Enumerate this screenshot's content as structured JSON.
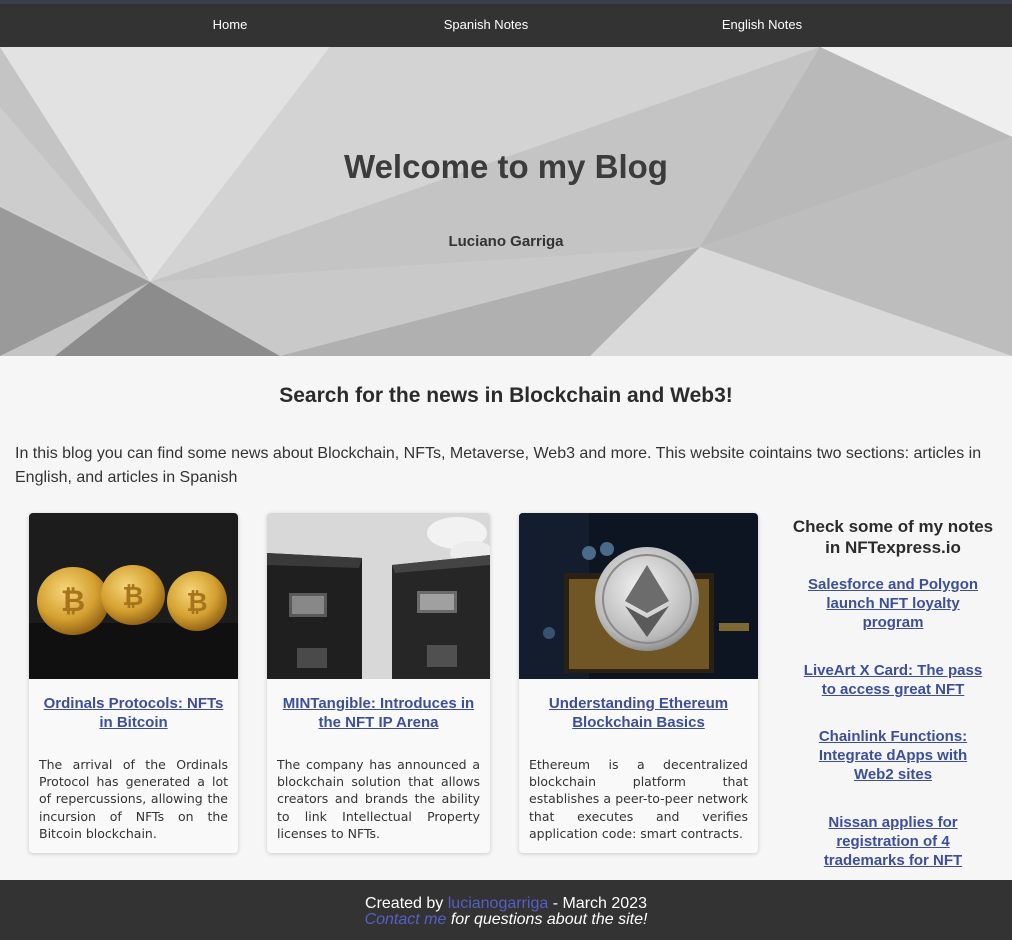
{
  "nav": {
    "items": [
      "Home",
      "Spanish Notes",
      "English Notes"
    ]
  },
  "hero": {
    "title": "Welcome to my Blog",
    "author": "Luciano Garriga"
  },
  "main": {
    "heading": "Search for the news in Blockchain and Web3!",
    "intro": "In this blog you can find some news about Blockchain, NFTs, Metaverse, Web3 and more. This website cointains two sections: articles in English, and articles in Spanish"
  },
  "cards": [
    {
      "title": "Ordinals Protocols: NFTs in Bitcoin",
      "text": "The arrival of the Ordinals Protocol has generated a lot of repercussions, allowing the incursion of NFTs on the Bitcoin blockchain.",
      "image": "bitcoin-coins-image"
    },
    {
      "title": "MINTangible: Introduces in the NFT IP Arena",
      "text": "The company has announced a blockchain solution that allows creators and brands the ability to link Intellectual Property licenses to NFTs.",
      "image": "buildings-image"
    },
    {
      "title": "Understanding Ethereum Blockchain Basics",
      "text": "Ethereum is a decentralized blockchain platform that establishes a peer-to-peer network that executes and verifies application code: smart contracts.",
      "image": "ethereum-coin-image"
    }
  ],
  "sidebar": {
    "heading": "Check some of my notes in NFTexpress.io",
    "links": [
      "Salesforce and Polygon launch NFT loyalty program",
      "LiveArt X Card: The pass to access great NFT",
      "Chainlink Functions: Integrate dApps with Web2 sites",
      "Nissan applies for registration of 4 trademarks for NFT"
    ]
  },
  "footer": {
    "created_prefix": "Created by",
    "author_link": "lucianogarriga",
    "date_suffix": "- March 2023",
    "contact_link": "Contact me",
    "contact_suffix": "for questions about the site!"
  },
  "colors": {
    "nav_bg": "#333333",
    "link": "#3d4f9b",
    "footer_link": "#5560c4",
    "page_bg": "#f6f6f6"
  }
}
